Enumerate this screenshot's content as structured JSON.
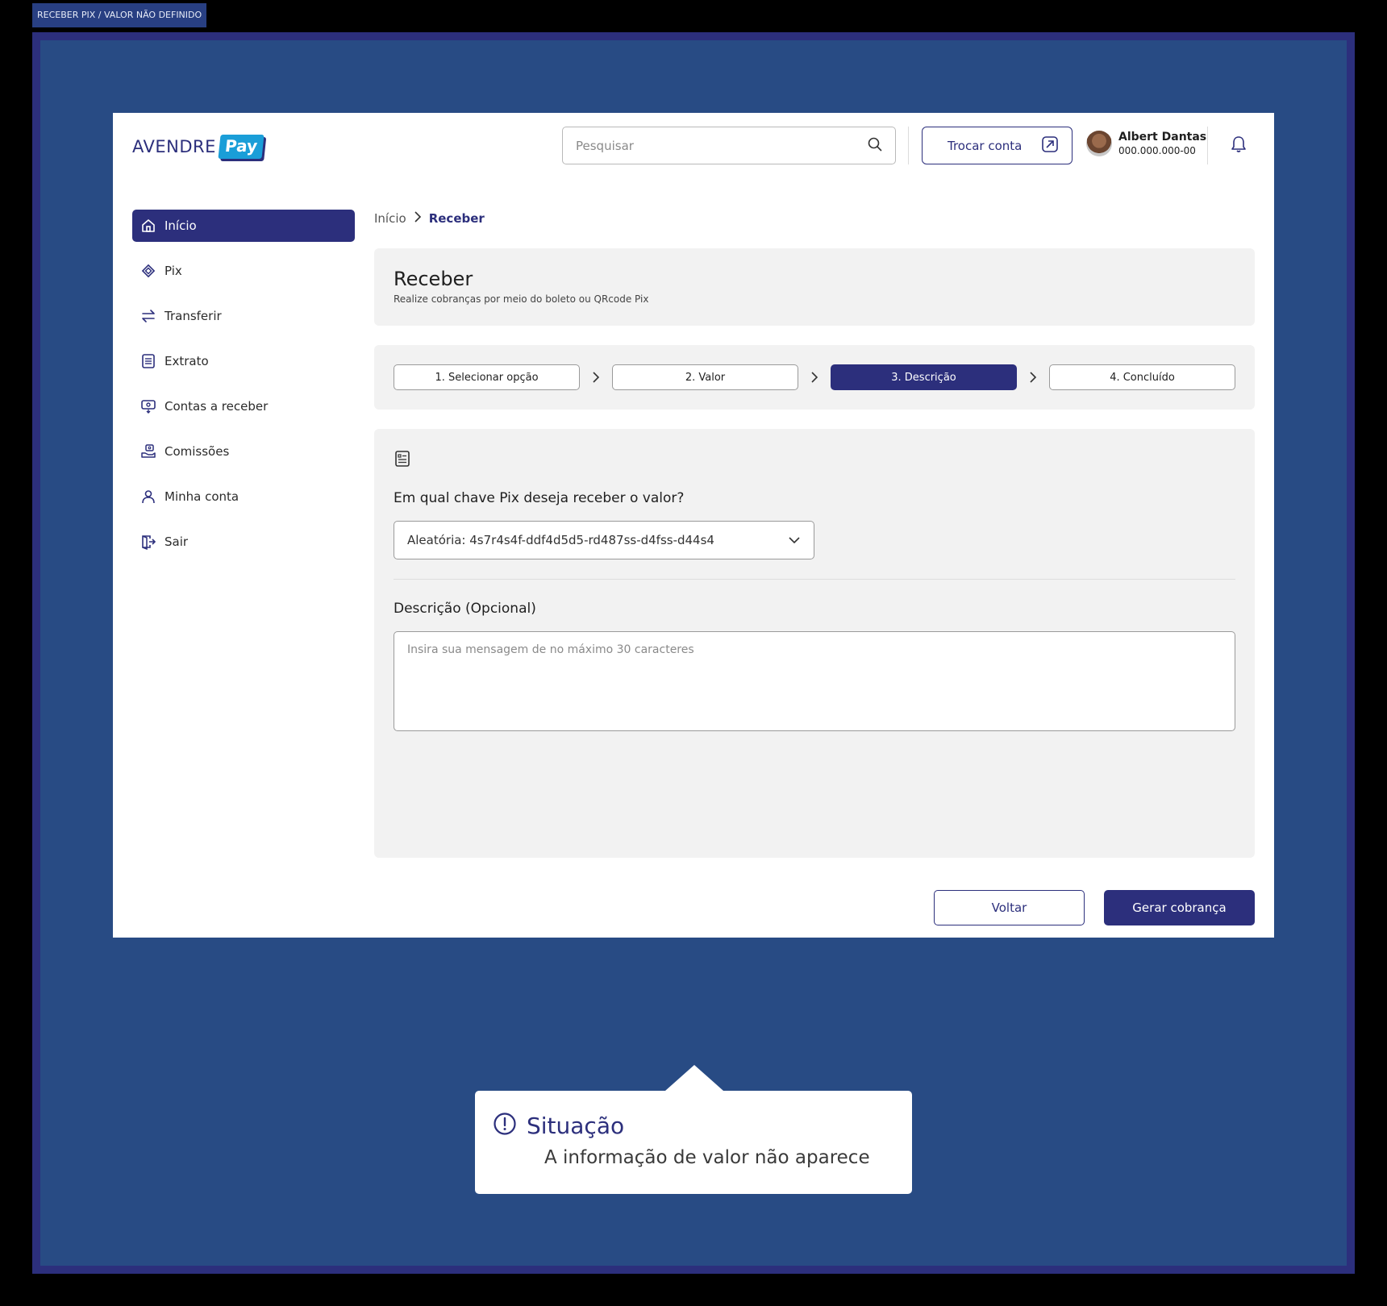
{
  "frame_label": "RECEBER PIX / VALOR NÃO DEFINIDO",
  "header": {
    "logo_text": "AVENDRE",
    "logo_badge": "Pay",
    "search_placeholder": "Pesquisar",
    "switch_account": "Trocar conta",
    "user_name": "Albert Dantas",
    "user_id": "000.000.000-00"
  },
  "sidebar": {
    "items": [
      {
        "label": "Início",
        "icon": "home-icon",
        "active": true
      },
      {
        "label": "Pix",
        "icon": "pix-icon"
      },
      {
        "label": "Transferir",
        "icon": "transfer-icon"
      },
      {
        "label": "Extrato",
        "icon": "statement-icon"
      },
      {
        "label": "Contas a receber",
        "icon": "receivables-icon"
      },
      {
        "label": "Comissões",
        "icon": "commission-icon"
      },
      {
        "label": "Minha conta",
        "icon": "user-icon"
      },
      {
        "label": "Sair",
        "icon": "logout-icon"
      }
    ]
  },
  "breadcrumb": {
    "root": "Início",
    "current": "Receber"
  },
  "page": {
    "title": "Receber",
    "subtitle": "Realize cobranças por meio do boleto ou QRcode Pix"
  },
  "steps": [
    {
      "label": "1. Selecionar opção"
    },
    {
      "label": "2. Valor"
    },
    {
      "label": "3. Descrição",
      "active": true
    },
    {
      "label": "4. Concluído"
    }
  ],
  "form": {
    "pix_question": "Em qual chave Pix deseja receber o valor?",
    "pix_key_selected": "Aleatória: 4s7r4s4f-ddf4d5d5-rd487ss-d4fss-d44s4",
    "description_label": "Descrição (Opcional)",
    "description_placeholder": "Insira sua mensagem de no máximo 30 caracteres"
  },
  "actions": {
    "back": "Voltar",
    "generate": "Gerar cobrança"
  },
  "callout": {
    "title": "Situação",
    "text": "A informação de valor não aparece"
  },
  "colors": {
    "primary": "#2c2f7c",
    "accent": "#1a9ed8",
    "canvas": "#284b84"
  }
}
